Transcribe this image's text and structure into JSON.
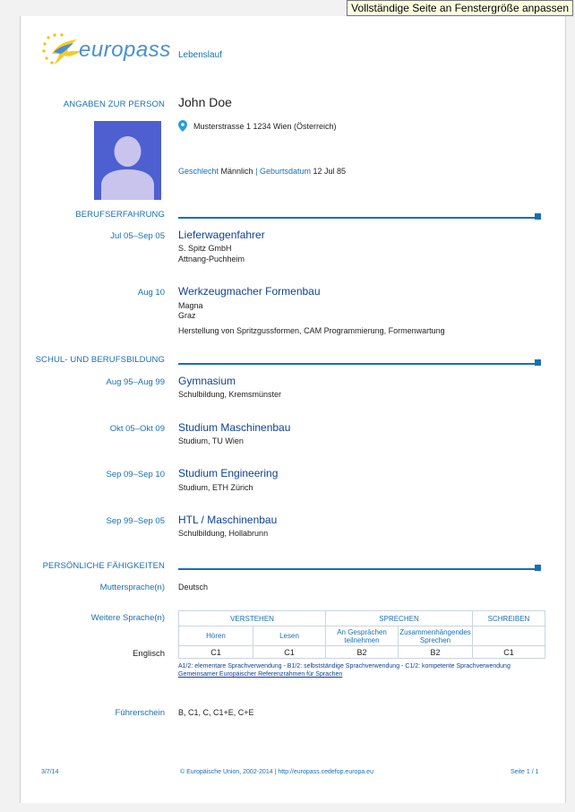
{
  "tooltip": "Vollständige Seite an Fenstergröße anpassen",
  "header": {
    "logo_text": "europass",
    "doc_type": "Lebenslauf"
  },
  "person": {
    "section_label": "ANGABEN ZUR PERSON",
    "name": "John Doe",
    "address": "Musterstrasse 1 1234 Wien (Österreich)",
    "gender_label": "Geschlecht",
    "gender": "Männlich",
    "sep": "|",
    "birth_label": "Geburtsdatum",
    "birth": "12 Jul 85"
  },
  "experience": {
    "section_label": "BERUFSERFAHRUNG",
    "items": [
      {
        "date": "Jul 05–Sep 05",
        "title": "Lieferwagenfahrer",
        "line1": "S. Spitz GmbH",
        "line2": "Attnang-Puchheim",
        "desc": ""
      },
      {
        "date": "Aug 10",
        "title": "Werkzeugmacher Formenbau",
        "line1": "Magna",
        "line2": "Graz",
        "desc": "Herstellung von Spritzgussformen, CAM Programmierung, Formenwartung"
      }
    ]
  },
  "education": {
    "section_label": "SCHUL- UND BERUFSBILDUNG",
    "items": [
      {
        "date": "Aug 95–Aug 99",
        "title": "Gymnasium",
        "line1": "Schulbildung, Kremsmünster"
      },
      {
        "date": "Okt 05–Okt 09",
        "title": "Studium Maschinenbau",
        "line1": "Studium, TU Wien"
      },
      {
        "date": "Sep 09–Sep 10",
        "title": "Studium Engineering",
        "line1": "Studium, ETH Zürich"
      },
      {
        "date": "Sep 99–Sep 05",
        "title": "HTL / Maschinenbau",
        "line1": "Schulbildung, Hollabrunn"
      }
    ]
  },
  "skills": {
    "section_label": "PERSÖNLICHE FÄHIGKEITEN",
    "mother_label": "Muttersprache(n)",
    "mother": "Deutsch",
    "other_label": "Weitere Sprache(n)",
    "table": {
      "h_verstehen": "VERSTEHEN",
      "h_sprechen": "SPRECHEN",
      "h_schreiben": "SCHREIBEN",
      "sub_hoeren": "Hören",
      "sub_lesen": "Lesen",
      "sub_gespraech": "An Gesprächen teilnehmen",
      "sub_zusammen": "Zusammenhängendes Sprechen"
    },
    "language": {
      "name": "Englisch",
      "levels": [
        "C1",
        "C1",
        "B2",
        "B2",
        "C1"
      ]
    },
    "legend": "A1/2: elementare Sprachverwendung - B1/2: selbstständige Sprachverwendung - C1/2: kompetente Sprachverwendung",
    "legend_link": "Gemeinsamer Europäischer Referenzrahmen für Sprachen",
    "license_label": "Führerschein",
    "license": "B, C1, C, C1+E, C+E"
  },
  "footer": {
    "left": "3/7/14",
    "center": "© Europäische Union, 2002-2014 | http://europass.cedefop.europa.eu",
    "right": "Seite 1 / 1"
  },
  "colors": {
    "accent": "#1a6fb4",
    "title": "#0e4194",
    "photo_bg": "#4e5fcf",
    "tooltip_bg": "#ffffe1"
  }
}
